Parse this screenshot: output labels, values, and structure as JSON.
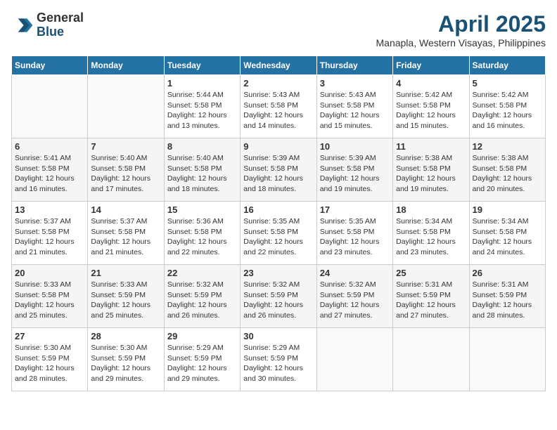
{
  "header": {
    "logo_general": "General",
    "logo_blue": "Blue",
    "month_year": "April 2025",
    "location": "Manapla, Western Visayas, Philippines"
  },
  "days_of_week": [
    "Sunday",
    "Monday",
    "Tuesday",
    "Wednesday",
    "Thursday",
    "Friday",
    "Saturday"
  ],
  "weeks": [
    [
      {
        "day": "",
        "sunrise": "",
        "sunset": "",
        "daylight": ""
      },
      {
        "day": "",
        "sunrise": "",
        "sunset": "",
        "daylight": ""
      },
      {
        "day": "1",
        "sunrise": "Sunrise: 5:44 AM",
        "sunset": "Sunset: 5:58 PM",
        "daylight": "Daylight: 12 hours and 13 minutes."
      },
      {
        "day": "2",
        "sunrise": "Sunrise: 5:43 AM",
        "sunset": "Sunset: 5:58 PM",
        "daylight": "Daylight: 12 hours and 14 minutes."
      },
      {
        "day": "3",
        "sunrise": "Sunrise: 5:43 AM",
        "sunset": "Sunset: 5:58 PM",
        "daylight": "Daylight: 12 hours and 15 minutes."
      },
      {
        "day": "4",
        "sunrise": "Sunrise: 5:42 AM",
        "sunset": "Sunset: 5:58 PM",
        "daylight": "Daylight: 12 hours and 15 minutes."
      },
      {
        "day": "5",
        "sunrise": "Sunrise: 5:42 AM",
        "sunset": "Sunset: 5:58 PM",
        "daylight": "Daylight: 12 hours and 16 minutes."
      }
    ],
    [
      {
        "day": "6",
        "sunrise": "Sunrise: 5:41 AM",
        "sunset": "Sunset: 5:58 PM",
        "daylight": "Daylight: 12 hours and 16 minutes."
      },
      {
        "day": "7",
        "sunrise": "Sunrise: 5:40 AM",
        "sunset": "Sunset: 5:58 PM",
        "daylight": "Daylight: 12 hours and 17 minutes."
      },
      {
        "day": "8",
        "sunrise": "Sunrise: 5:40 AM",
        "sunset": "Sunset: 5:58 PM",
        "daylight": "Daylight: 12 hours and 18 minutes."
      },
      {
        "day": "9",
        "sunrise": "Sunrise: 5:39 AM",
        "sunset": "Sunset: 5:58 PM",
        "daylight": "Daylight: 12 hours and 18 minutes."
      },
      {
        "day": "10",
        "sunrise": "Sunrise: 5:39 AM",
        "sunset": "Sunset: 5:58 PM",
        "daylight": "Daylight: 12 hours and 19 minutes."
      },
      {
        "day": "11",
        "sunrise": "Sunrise: 5:38 AM",
        "sunset": "Sunset: 5:58 PM",
        "daylight": "Daylight: 12 hours and 19 minutes."
      },
      {
        "day": "12",
        "sunrise": "Sunrise: 5:38 AM",
        "sunset": "Sunset: 5:58 PM",
        "daylight": "Daylight: 12 hours and 20 minutes."
      }
    ],
    [
      {
        "day": "13",
        "sunrise": "Sunrise: 5:37 AM",
        "sunset": "Sunset: 5:58 PM",
        "daylight": "Daylight: 12 hours and 21 minutes."
      },
      {
        "day": "14",
        "sunrise": "Sunrise: 5:37 AM",
        "sunset": "Sunset: 5:58 PM",
        "daylight": "Daylight: 12 hours and 21 minutes."
      },
      {
        "day": "15",
        "sunrise": "Sunrise: 5:36 AM",
        "sunset": "Sunset: 5:58 PM",
        "daylight": "Daylight: 12 hours and 22 minutes."
      },
      {
        "day": "16",
        "sunrise": "Sunrise: 5:35 AM",
        "sunset": "Sunset: 5:58 PM",
        "daylight": "Daylight: 12 hours and 22 minutes."
      },
      {
        "day": "17",
        "sunrise": "Sunrise: 5:35 AM",
        "sunset": "Sunset: 5:58 PM",
        "daylight": "Daylight: 12 hours and 23 minutes."
      },
      {
        "day": "18",
        "sunrise": "Sunrise: 5:34 AM",
        "sunset": "Sunset: 5:58 PM",
        "daylight": "Daylight: 12 hours and 23 minutes."
      },
      {
        "day": "19",
        "sunrise": "Sunrise: 5:34 AM",
        "sunset": "Sunset: 5:58 PM",
        "daylight": "Daylight: 12 hours and 24 minutes."
      }
    ],
    [
      {
        "day": "20",
        "sunrise": "Sunrise: 5:33 AM",
        "sunset": "Sunset: 5:58 PM",
        "daylight": "Daylight: 12 hours and 25 minutes."
      },
      {
        "day": "21",
        "sunrise": "Sunrise: 5:33 AM",
        "sunset": "Sunset: 5:59 PM",
        "daylight": "Daylight: 12 hours and 25 minutes."
      },
      {
        "day": "22",
        "sunrise": "Sunrise: 5:32 AM",
        "sunset": "Sunset: 5:59 PM",
        "daylight": "Daylight: 12 hours and 26 minutes."
      },
      {
        "day": "23",
        "sunrise": "Sunrise: 5:32 AM",
        "sunset": "Sunset: 5:59 PM",
        "daylight": "Daylight: 12 hours and 26 minutes."
      },
      {
        "day": "24",
        "sunrise": "Sunrise: 5:32 AM",
        "sunset": "Sunset: 5:59 PM",
        "daylight": "Daylight: 12 hours and 27 minutes."
      },
      {
        "day": "25",
        "sunrise": "Sunrise: 5:31 AM",
        "sunset": "Sunset: 5:59 PM",
        "daylight": "Daylight: 12 hours and 27 minutes."
      },
      {
        "day": "26",
        "sunrise": "Sunrise: 5:31 AM",
        "sunset": "Sunset: 5:59 PM",
        "daylight": "Daylight: 12 hours and 28 minutes."
      }
    ],
    [
      {
        "day": "27",
        "sunrise": "Sunrise: 5:30 AM",
        "sunset": "Sunset: 5:59 PM",
        "daylight": "Daylight: 12 hours and 28 minutes."
      },
      {
        "day": "28",
        "sunrise": "Sunrise: 5:30 AM",
        "sunset": "Sunset: 5:59 PM",
        "daylight": "Daylight: 12 hours and 29 minutes."
      },
      {
        "day": "29",
        "sunrise": "Sunrise: 5:29 AM",
        "sunset": "Sunset: 5:59 PM",
        "daylight": "Daylight: 12 hours and 29 minutes."
      },
      {
        "day": "30",
        "sunrise": "Sunrise: 5:29 AM",
        "sunset": "Sunset: 5:59 PM",
        "daylight": "Daylight: 12 hours and 30 minutes."
      },
      {
        "day": "",
        "sunrise": "",
        "sunset": "",
        "daylight": ""
      },
      {
        "day": "",
        "sunrise": "",
        "sunset": "",
        "daylight": ""
      },
      {
        "day": "",
        "sunrise": "",
        "sunset": "",
        "daylight": ""
      }
    ]
  ]
}
